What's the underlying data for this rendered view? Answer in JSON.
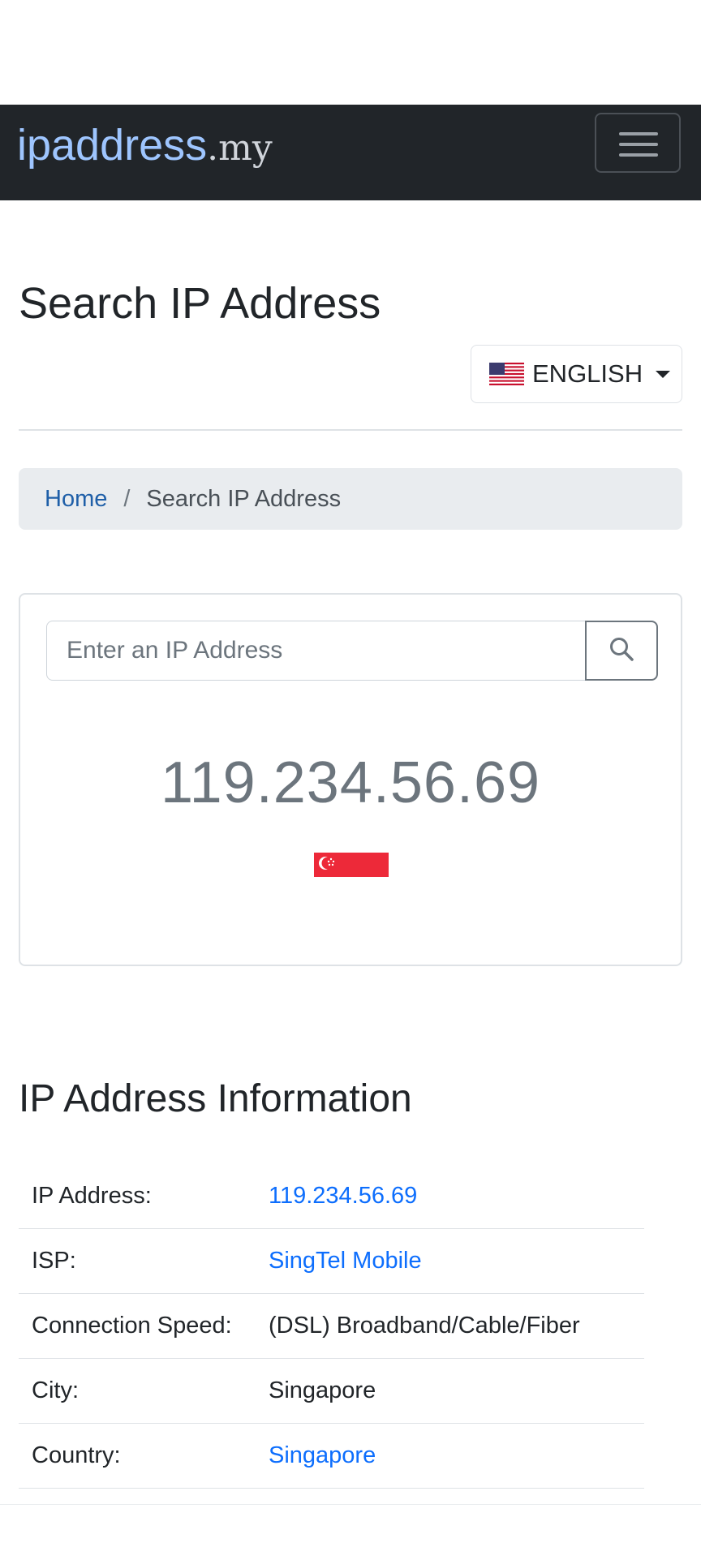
{
  "navbar": {
    "brand_main": "ipaddress",
    "brand_tld": ".my",
    "menu_toggle_icon": "hamburger-icon"
  },
  "page": {
    "title": "Search IP Address"
  },
  "language": {
    "label": "ENGLISH",
    "flag_icon": "us-flag-icon"
  },
  "breadcrumb": {
    "home": "Home",
    "separator": "/",
    "current": "Search IP Address"
  },
  "search": {
    "placeholder": "Enter an IP Address",
    "value": "",
    "button_icon": "search-icon"
  },
  "result": {
    "ip": "119.234.56.69",
    "flag_icon": "singapore-flag-icon"
  },
  "info": {
    "title": "IP Address Information",
    "rows": [
      {
        "key": "IP Address:",
        "value": "119.234.56.69",
        "is_link": true
      },
      {
        "key": "ISP:",
        "value": "SingTel Mobile",
        "is_link": true
      },
      {
        "key": "Connection Speed:",
        "value": "(DSL) Broadband/Cable/Fiber",
        "is_link": false
      },
      {
        "key": "City:",
        "value": "Singapore",
        "is_link": false
      },
      {
        "key": "Country:",
        "value": "Singapore",
        "is_link": true
      }
    ]
  },
  "colors": {
    "navbar_bg": "#212529",
    "brand_blue": "#9ec5fe",
    "link_blue": "#0d6efd",
    "breadcrumb_bg": "#e9ecef",
    "muted_text": "#6c757d",
    "sg_red": "#ed2939"
  }
}
